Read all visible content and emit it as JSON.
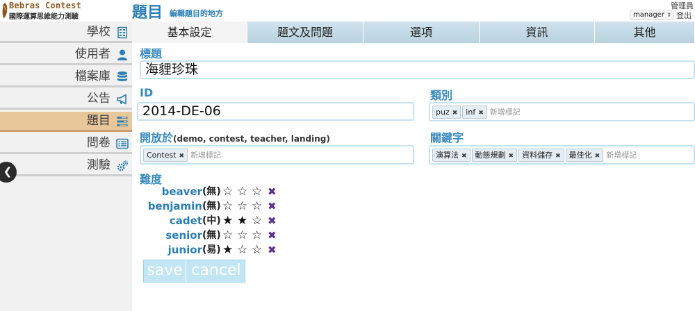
{
  "header": {
    "logo_title": "Bebras Contest",
    "logo_subtitle": "國際運算思維能力測驗",
    "page_title": "題目",
    "page_subtitle": "編輯題目的地方",
    "admin_label": "管理員",
    "user_select_value": "manager",
    "logout_label": "登出"
  },
  "sidebar": {
    "items": [
      {
        "label": "學校",
        "icon": "school-grid-icon"
      },
      {
        "label": "使用者",
        "icon": "user-icon"
      },
      {
        "label": "檔案庫",
        "icon": "database-icon"
      },
      {
        "label": "公告",
        "icon": "bullhorn-icon"
      },
      {
        "label": "題目",
        "icon": "tasks-icon",
        "active": true
      },
      {
        "label": "問卷",
        "icon": "list-alt-icon"
      },
      {
        "label": "測驗",
        "icon": "gears-icon"
      }
    ]
  },
  "tabs": [
    {
      "label": "基本設定",
      "active": true
    },
    {
      "label": "題文及問題"
    },
    {
      "label": "選項"
    },
    {
      "label": "資訊"
    },
    {
      "label": "其他"
    }
  ],
  "form": {
    "title_label": "標題",
    "title_value": "海貍珍珠",
    "id_label": "ID",
    "id_value": "2014-DE-06",
    "category_label": "類別",
    "category_tags": [
      "puz",
      "inf"
    ],
    "open_label": "開放於",
    "open_hint": "(demo, contest, teacher, landing)",
    "open_tags": [
      "Contest"
    ],
    "keywords_label": "關鍵字",
    "keyword_tags": [
      "演算法",
      "動態規劃",
      "資料儲存",
      "最佳化"
    ],
    "tag_placeholder": "新增標記",
    "difficulty_label": "難度",
    "difficulty": [
      {
        "group": "beaver",
        "level": "(無)",
        "stars": 0
      },
      {
        "group": "benjamin",
        "level": "(無)",
        "stars": 0
      },
      {
        "group": "cadet",
        "level": "(中)",
        "stars": 2
      },
      {
        "group": "senior",
        "level": "(無)",
        "stars": 0
      },
      {
        "group": "junior",
        "level": "(易)",
        "stars": 1
      }
    ],
    "save_label": "save",
    "cancel_label": "cancel"
  },
  "colors": {
    "accent": "#2a7fb6",
    "sidebar_active": "#e7c79a",
    "tab_bg": "#c5dce8",
    "button_bg": "#c2e6f3",
    "clear_x": "#5a2f8e"
  }
}
